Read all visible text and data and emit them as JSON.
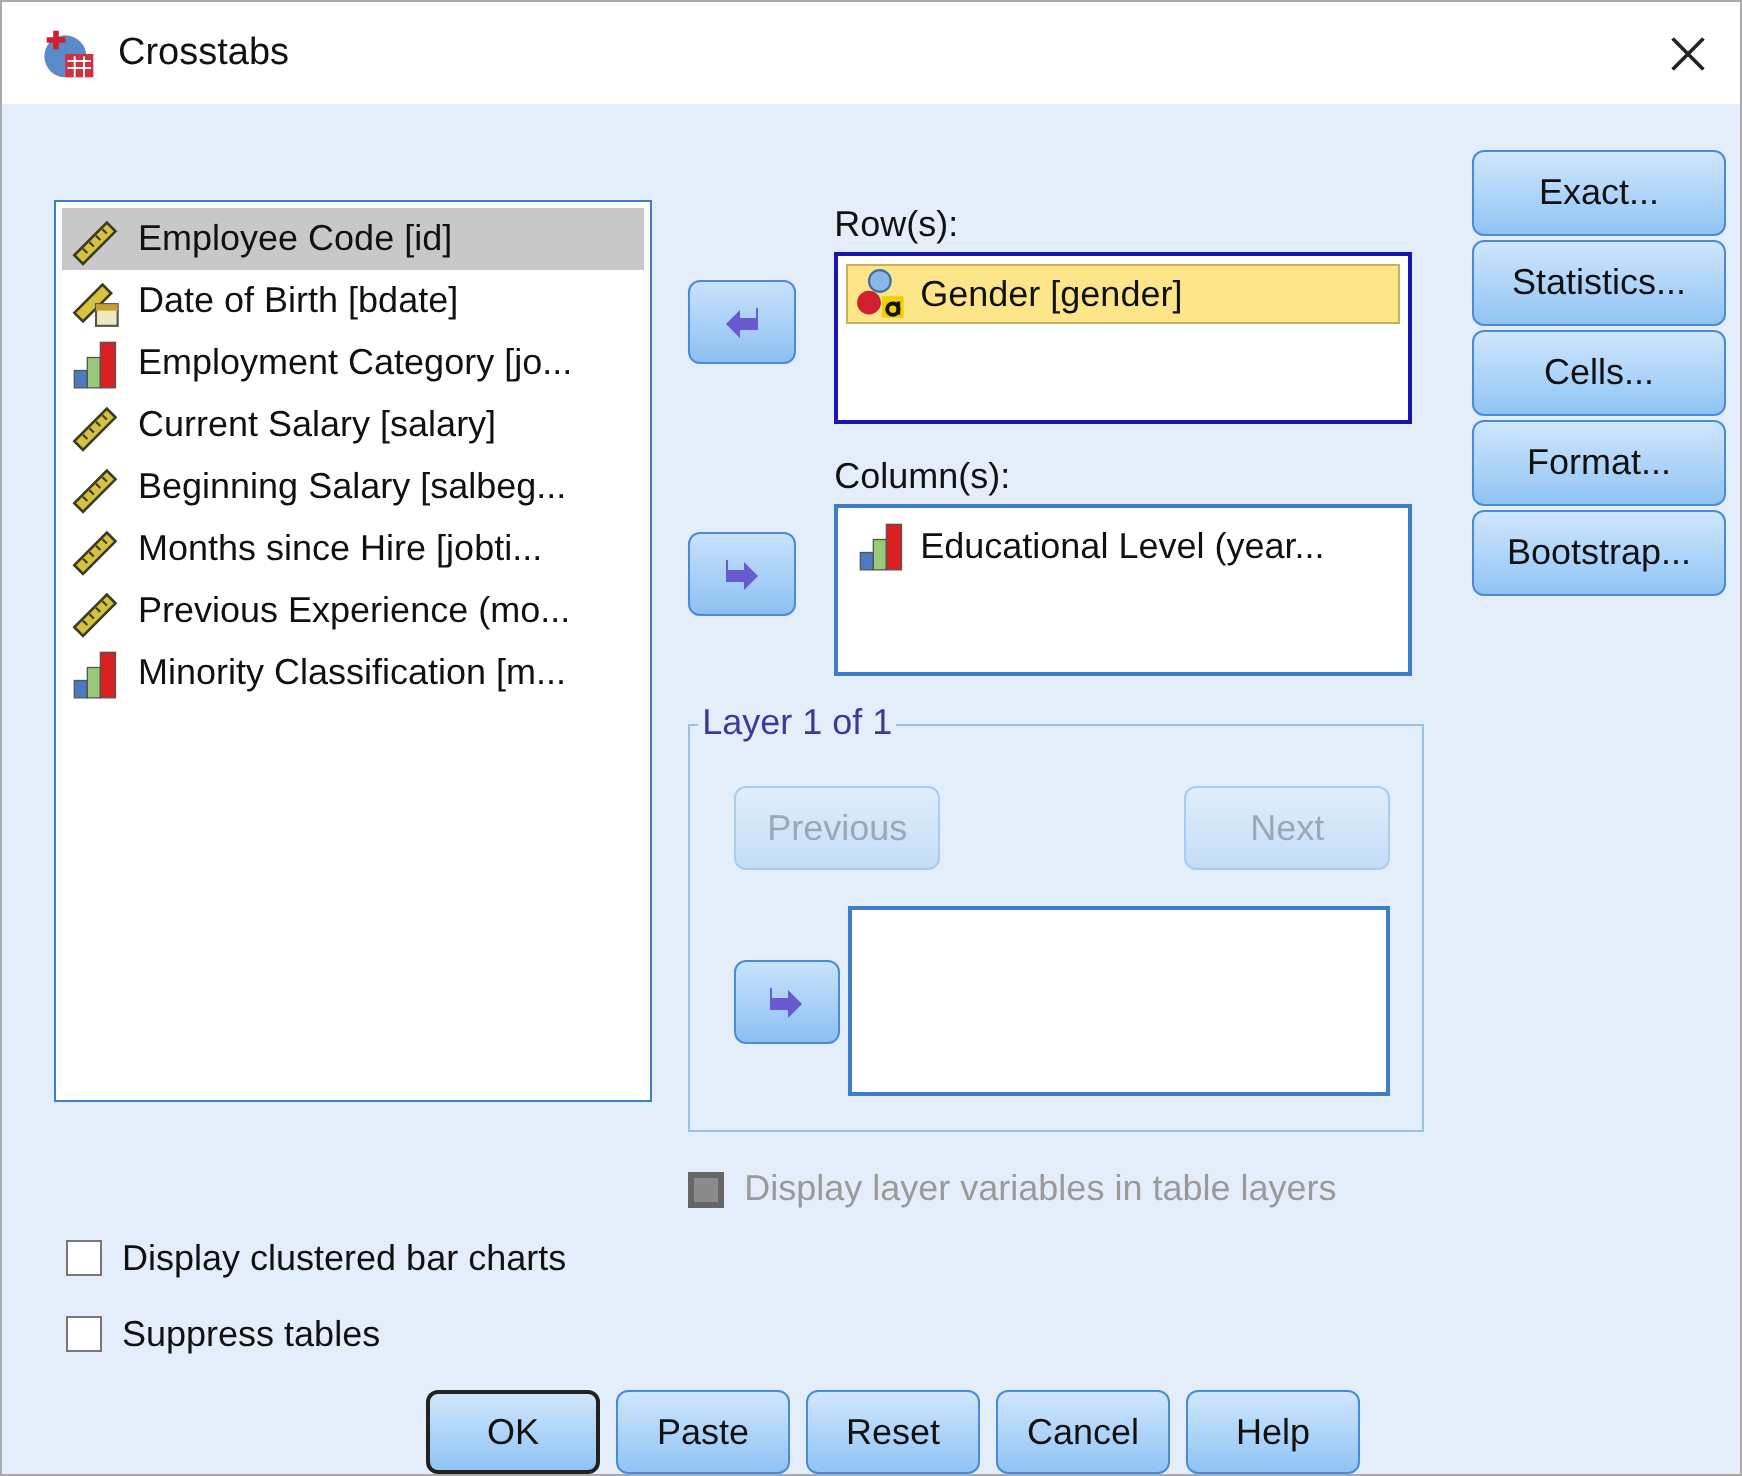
{
  "window": {
    "title": "Crosstabs"
  },
  "variables": [
    {
      "label": "Employee Code [id]",
      "kind": "scale",
      "selected": true
    },
    {
      "label": "Date of Birth [bdate]",
      "kind": "date",
      "selected": false
    },
    {
      "label": "Employment Category [jo...",
      "kind": "ordinal",
      "selected": false
    },
    {
      "label": "Current Salary [salary]",
      "kind": "scale",
      "selected": false
    },
    {
      "label": "Beginning Salary [salbeg...",
      "kind": "scale",
      "selected": false
    },
    {
      "label": "Months since Hire [jobti...",
      "kind": "scale",
      "selected": false
    },
    {
      "label": "Previous Experience (mo...",
      "kind": "scale",
      "selected": false
    },
    {
      "label": "Minority Classification [m...",
      "kind": "ordinal",
      "selected": false
    }
  ],
  "rows": {
    "label": "Row(s):",
    "items": [
      {
        "label": "Gender [gender]",
        "kind": "nominal",
        "selected": true
      }
    ]
  },
  "columns": {
    "label": "Column(s):",
    "items": [
      {
        "label": "Educational Level (year...",
        "kind": "ordinal",
        "selected": false
      }
    ]
  },
  "layer": {
    "title": "Layer 1 of 1",
    "previous": {
      "label": "Previous",
      "disabled": true
    },
    "next": {
      "label": "Next",
      "disabled": true
    }
  },
  "display_layer": {
    "label": "Display layer variables in table layers",
    "checked": false,
    "disabled": true
  },
  "side_buttons": [
    "Exact...",
    "Statistics...",
    "Cells...",
    "Format...",
    "Bootstrap..."
  ],
  "options": [
    {
      "label": "Display clustered bar charts",
      "checked": false
    },
    {
      "label": "Suppress tables",
      "checked": false
    }
  ],
  "buttons": [
    {
      "label": "OK",
      "default": true
    },
    {
      "label": "Paste",
      "default": false
    },
    {
      "label": "Reset",
      "default": false
    },
    {
      "label": "Cancel",
      "default": false
    },
    {
      "label": "Help",
      "default": false
    }
  ]
}
